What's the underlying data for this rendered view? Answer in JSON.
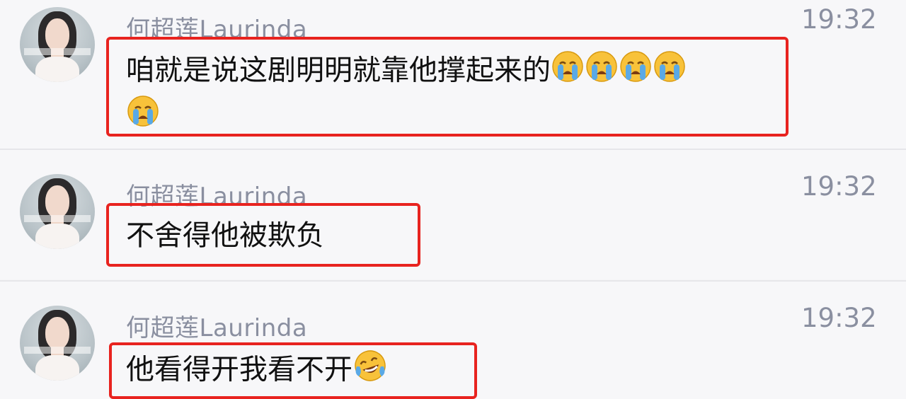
{
  "messages": [
    {
      "name": "何超莲Laurinda",
      "time": "19:32",
      "text": "咱就是说这剧明明就靠他撑起来的",
      "emojis": [
        "crying-face",
        "crying-face",
        "crying-face",
        "crying-face",
        "crying-face"
      ]
    },
    {
      "name": "何超莲Laurinda",
      "time": "19:32",
      "text": "不舍得他被欺负",
      "emojis": []
    },
    {
      "name": "何超莲Laurinda",
      "time": "19:32",
      "text": "他看得开我看不开",
      "emojis": [
        "laughing-crying-face"
      ]
    }
  ],
  "colors": {
    "highlight_border": "#e8231f",
    "meta_text": "#8a8fa0",
    "message_text": "#111111",
    "background": "#f6f6f8"
  }
}
